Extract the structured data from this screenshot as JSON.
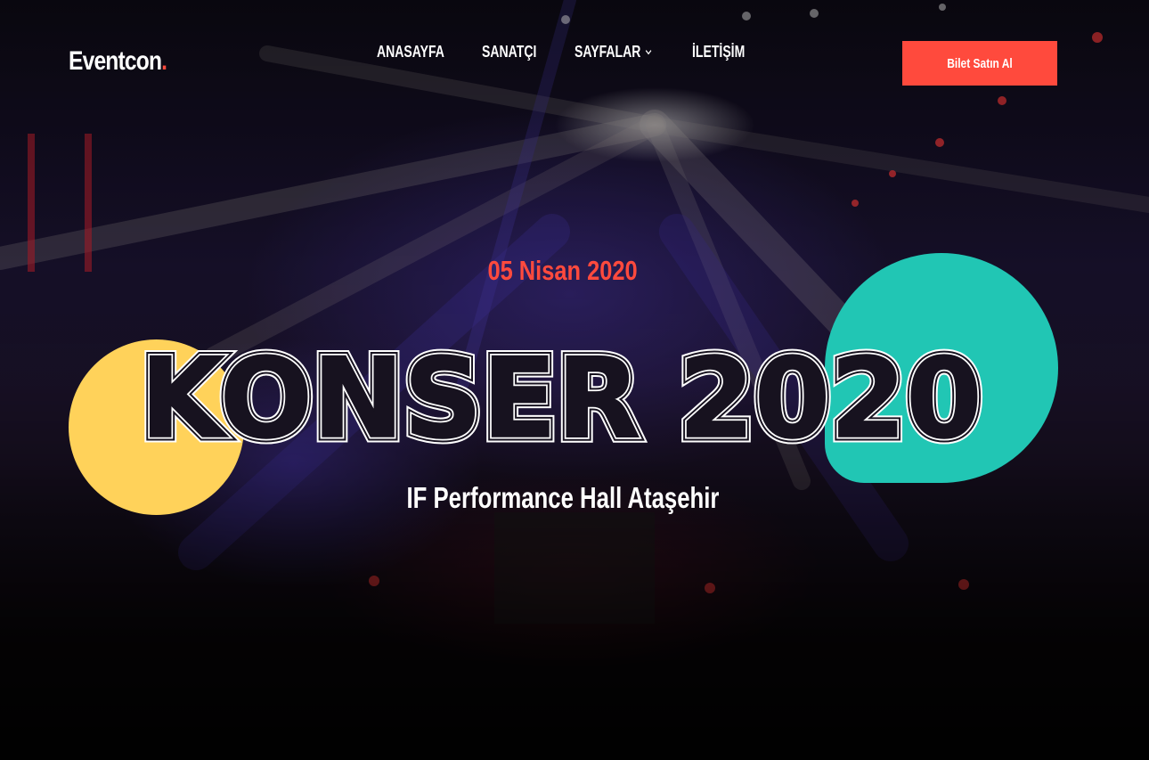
{
  "header": {
    "logo_text": "Eventcon",
    "logo_dot": ".",
    "nav": [
      {
        "label": "ANASAYFA"
      },
      {
        "label": "SANATÇI"
      },
      {
        "label": "SAYFALAR",
        "has_dropdown": true
      },
      {
        "label": "İLETİŞİM"
      }
    ],
    "cta_label": "Bilet Satın Al"
  },
  "hero": {
    "date": "05 Nisan 2020",
    "title": "KONSER 2020",
    "venue": "IF Performance Hall Ataşehir"
  },
  "colors": {
    "accent": "#ff4a3d",
    "yellow": "#ffd25a",
    "teal": "#21c6b4",
    "text": "#ffffff"
  },
  "icons": {
    "dropdown": "chevron-down-icon"
  }
}
